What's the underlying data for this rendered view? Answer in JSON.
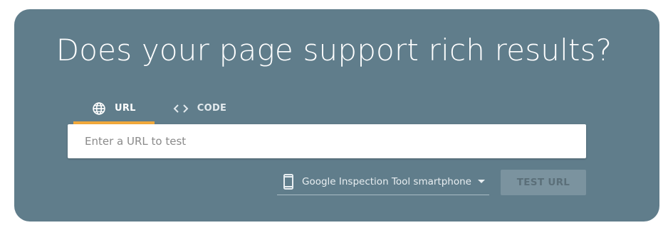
{
  "hero": {
    "title": "Does your page support rich results?"
  },
  "tabs": [
    {
      "label": "URL",
      "icon": "globe-icon",
      "active": true
    },
    {
      "label": "CODE",
      "icon": "code-icon",
      "active": false
    }
  ],
  "url_input": {
    "placeholder": "Enter a URL to test",
    "value": ""
  },
  "device_select": {
    "icon": "smartphone-icon",
    "selected": "Google Inspection Tool smartphone"
  },
  "test_button": {
    "label": "TEST URL",
    "enabled": false
  },
  "colors": {
    "card_background": "#607d8b",
    "active_tab_indicator": "#f2a93b",
    "button_disabled": "#7b939f"
  }
}
